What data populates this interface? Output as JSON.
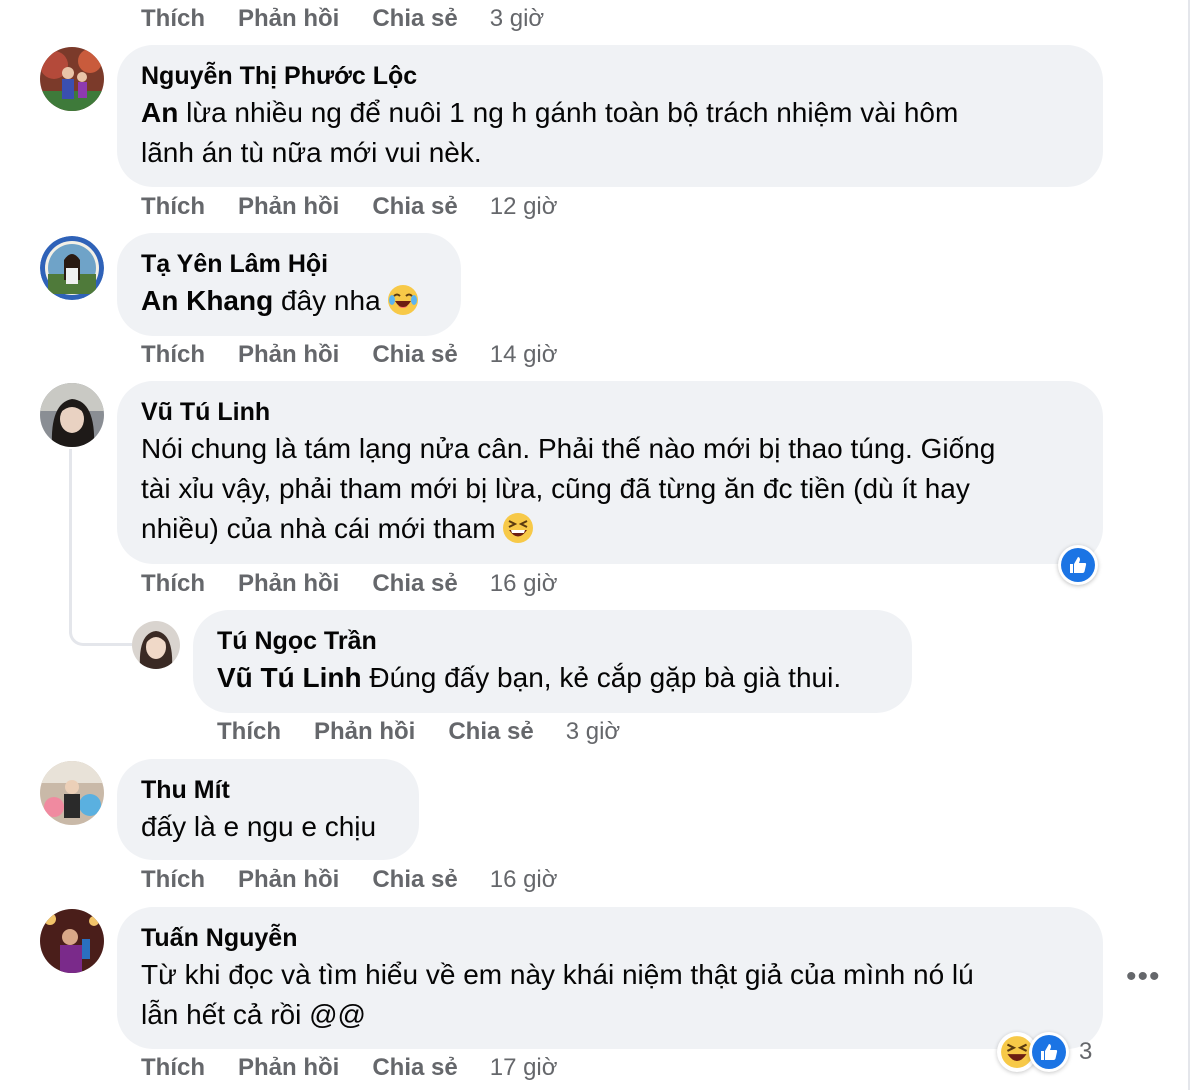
{
  "actions": {
    "like": "Thích",
    "reply": "Phản hồi",
    "share": "Chia sẻ"
  },
  "comments": [
    {
      "time": "3 giờ"
    },
    {
      "name": "Nguyễn Thị Phước Lộc",
      "mention": "An",
      "line1": " lừa nhiều ng để nuôi 1 ng h gánh toàn bộ trách nhiệm vài hôm",
      "line2": "lãnh án tù nữa mới vui nèk.",
      "time": "12 giờ"
    },
    {
      "name": "Tạ Yên Lâm Hội",
      "mention": "An Khang",
      "line1": " đây nha",
      "emoji": "laugh-tears-emoji",
      "time": "14 giờ"
    },
    {
      "name": "Vũ Tú Linh",
      "line1": "Nói chung là tám lạng nửa cân. Phải thế nào mới bị thao túng. Giống",
      "line2": "tài xỉu vậy, phải tham mới bị lừa, cũng đã từng ăn đc tiền (dù ít hay",
      "line3": "nhiều) của nhà cái mới tham",
      "emoji": "grin-squint-emoji",
      "reaction": "like",
      "time": "16 giờ"
    },
    {
      "name": "Tú Ngọc Trần",
      "mention": "Vũ Tú Linh",
      "line1": " Đúng đấy bạn, kẻ cắp gặp bà già thui.",
      "time": "3 giờ"
    },
    {
      "name": "Thu Mít",
      "line1": "đấy là e ngu e chịu",
      "time": "16 giờ"
    },
    {
      "name": "Tuấn Nguyễn",
      "line1": "Từ khi đọc và tìm hiểu về em này khái niệm thật giả của mình nó lú",
      "line2": "lẫn hết cả rồi @@",
      "reaction_count": "3",
      "more": "•••",
      "time": "17 giờ"
    }
  ],
  "colors": {
    "bubble": "#f0f2f5",
    "meta": "#65676b",
    "like_blue": "#1b74e4",
    "text": "#050505"
  }
}
